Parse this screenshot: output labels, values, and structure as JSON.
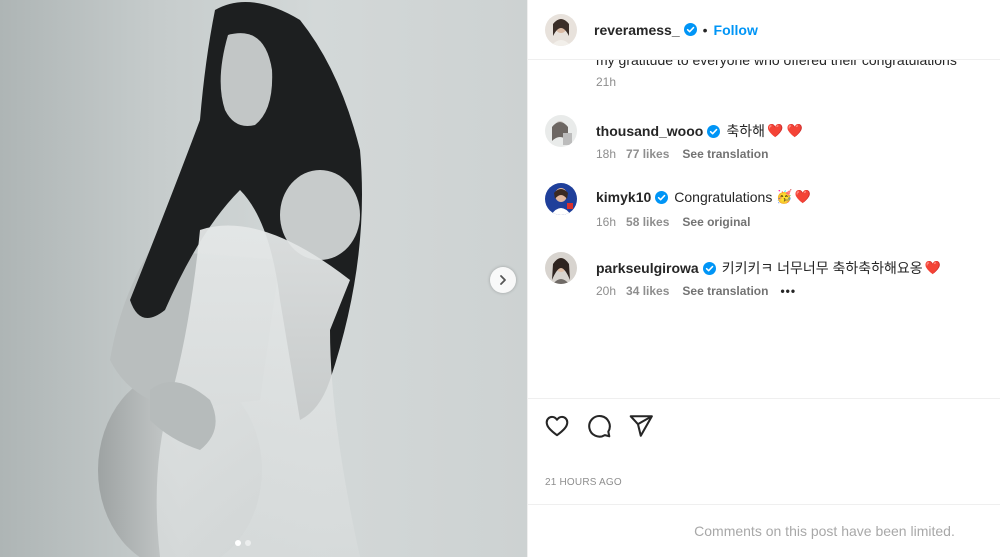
{
  "post": {
    "author": {
      "username": "reveramess_",
      "verified": true
    },
    "header": {
      "separator": "•",
      "follow_label": "Follow"
    },
    "caption": {
      "visible_text": "my gratitude to everyone who offered their congratulations",
      "time": "21h"
    },
    "carousel": {
      "total_slides": 2,
      "active_slide": 1
    }
  },
  "comments": [
    {
      "username": "thousand_wooo",
      "verified": true,
      "text": "축하해",
      "hearts": "❤️ ❤️",
      "emoji": "",
      "time": "18h",
      "likes": "77 likes",
      "action": "See translation",
      "show_more": false
    },
    {
      "username": "kimyk10",
      "verified": true,
      "text": "Congratulations",
      "hearts": "❤️",
      "emoji": "🥳",
      "time": "16h",
      "likes": "58 likes",
      "action": "See original",
      "show_more": false
    },
    {
      "username": "parkseulgirowa",
      "verified": true,
      "text": "키키키ㅋ 너무너무 축하축하해요옹",
      "hearts": "❤️",
      "emoji": "",
      "time": "20h",
      "likes": "34 likes",
      "action": "See translation",
      "show_more": true,
      "more_label": "•••"
    }
  ],
  "actions": {
    "like_icon": "heart-icon",
    "comment_icon": "comment-bubble-icon",
    "share_icon": "paper-plane-icon",
    "timestamp": "21 HOURS AGO"
  },
  "footer": {
    "notice": "Comments on this post have been limited."
  },
  "colors": {
    "link": "#0095f6",
    "verified": "#0095f6",
    "heart": "#ed4956",
    "secondary_text": "#8e8e8e"
  }
}
